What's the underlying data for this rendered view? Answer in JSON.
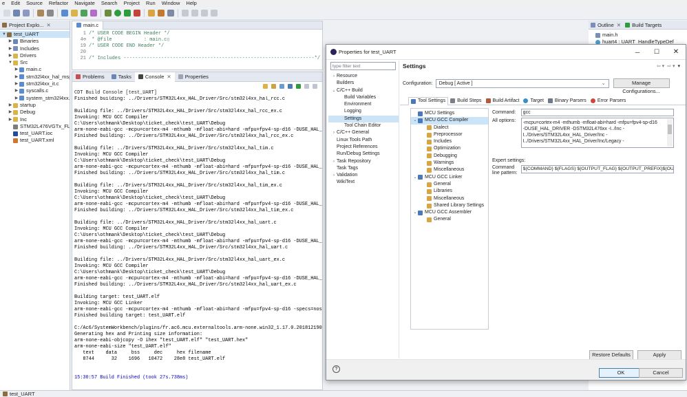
{
  "menubar": [
    "e",
    "Edit",
    "Source",
    "Refactor",
    "Navigate",
    "Search",
    "Project",
    "Run",
    "Window",
    "Help"
  ],
  "project_explorer": {
    "title": "Project Explo...",
    "items": [
      {
        "label": "test_UART",
        "depth": 0,
        "twisty": "▼",
        "icon": "project-icon",
        "selected": true
      },
      {
        "label": "Binaries",
        "depth": 1,
        "twisty": "▶",
        "icon": "binaries-icon"
      },
      {
        "label": "Includes",
        "depth": 1,
        "twisty": "▶",
        "icon": "includes-icon"
      },
      {
        "label": "Drivers",
        "depth": 1,
        "twisty": "▶",
        "icon": "folder-icon"
      },
      {
        "label": "Src",
        "depth": 1,
        "twisty": "▼",
        "icon": "folder-icon"
      },
      {
        "label": "main.c",
        "depth": 2,
        "twisty": "▶",
        "icon": "c-file-icon"
      },
      {
        "label": "stm32l4xx_hal_msp.",
        "depth": 2,
        "twisty": "▶",
        "icon": "c-file-icon"
      },
      {
        "label": "stm32l4xx_it.c",
        "depth": 2,
        "twisty": "▶",
        "icon": "c-file-icon"
      },
      {
        "label": "syscalls.c",
        "depth": 2,
        "twisty": "▶",
        "icon": "c-file-icon"
      },
      {
        "label": "system_stm32l4xx.c",
        "depth": 2,
        "twisty": "▶",
        "icon": "c-file-icon"
      },
      {
        "label": "startup",
        "depth": 1,
        "twisty": "▶",
        "icon": "folder-icon"
      },
      {
        "label": "Debug",
        "depth": 1,
        "twisty": "▶",
        "icon": "folder-icon"
      },
      {
        "label": "Inc",
        "depth": 1,
        "twisty": "▶",
        "icon": "folder-icon"
      },
      {
        "label": "STM32L476VGTx_FLASH",
        "depth": 1,
        "twisty": "",
        "icon": "ld-file-icon"
      },
      {
        "label": "test_UART.ioc",
        "depth": 1,
        "twisty": "",
        "icon": "ioc-file-icon"
      },
      {
        "label": "test_UART.xml",
        "depth": 1,
        "twisty": "",
        "icon": "xml-file-icon"
      }
    ]
  },
  "editor": {
    "tab": "main.c",
    "lines": [
      {
        "num": "1",
        "text": "/* USER CODE BEGIN Header */"
      },
      {
        "num": "4⊖",
        "text": " * @file           : main.c▯"
      },
      {
        "num": "19",
        "text": "/* USER CODE END Header */"
      },
      {
        "num": "20",
        "text": ""
      },
      {
        "num": "21",
        "text": "/* Includes ------------------------------------------------------------------*/"
      }
    ]
  },
  "console": {
    "tabs": [
      "Problems",
      "Tasks",
      "Console",
      "Properties"
    ],
    "title": "CDT Build Console [test_UART]",
    "lines": [
      "Finished building: ../Drivers/STM32L4xx_HAL_Driver/Src/stm32l4xx_hal_rcc.c",
      "",
      "Building file: ../Drivers/STM32L4xx_HAL_Driver/Src/stm32l4xx_hal_rcc_ex.c",
      "Invoking: MCU GCC Compiler",
      "C:\\Users\\othmank\\Desktop\\ticket_check\\test_UART\\Debug",
      "arm-none-eabi-gcc -mcpu=cortex-m4 -mthumb -mfloat-abi=hard -mfpu=fpv4-sp-d16 -DUSE_HAL_",
      "Finished building: ../Drivers/STM32L4xx_HAL_Driver/Src/stm32l4xx_hal_rcc_ex.c",
      "",
      "Building file: ../Drivers/STM32L4xx_HAL_Driver/Src/stm32l4xx_hal_tim.c",
      "Invoking: MCU GCC Compiler",
      "C:\\Users\\othmank\\Desktop\\ticket_check\\test_UART\\Debug",
      "arm-none-eabi-gcc -mcpu=cortex-m4 -mthumb -mfloat-abi=hard -mfpu=fpv4-sp-d16 -DUSE_HAL_",
      "Finished building: ../Drivers/STM32L4xx_HAL_Driver/Src/stm32l4xx_hal_tim.c",
      "",
      "Building file: ../Drivers/STM32L4xx_HAL_Driver/Src/stm32l4xx_hal_tim_ex.c",
      "Invoking: MCU GCC Compiler",
      "C:\\Users\\othmank\\Desktop\\ticket_check\\test_UART\\Debug",
      "arm-none-eabi-gcc -mcpu=cortex-m4 -mthumb -mfloat-abi=hard -mfpu=fpv4-sp-d16 -DUSE_HAL_",
      "Finished building: ../Drivers/STM32L4xx_HAL_Driver/Src/stm32l4xx_hal_tim_ex.c",
      "",
      "Building file: ../Drivers/STM32L4xx_HAL_Driver/Src/stm32l4xx_hal_uart.c",
      "Invoking: MCU GCC Compiler",
      "C:\\Users\\othmank\\Desktop\\ticket_check\\test_UART\\Debug",
      "arm-none-eabi-gcc -mcpu=cortex-m4 -mthumb -mfloat-abi=hard -mfpu=fpv4-sp-d16 -DUSE_HAL_",
      "Finished building: ../Drivers/STM32L4xx_HAL_Driver/Src/stm32l4xx_hal_uart.c",
      "",
      "Building file: ../Drivers/STM32L4xx_HAL_Driver/Src/stm32l4xx_hal_uart_ex.c",
      "Invoking: MCU GCC Compiler",
      "C:\\Users\\othmank\\Desktop\\ticket_check\\test_UART\\Debug",
      "arm-none-eabi-gcc -mcpu=cortex-m4 -mthumb -mfloat-abi=hard -mfpu=fpv4-sp-d16 -DUSE_HAL_",
      "Finished building: ../Drivers/STM32L4xx_HAL_Driver/Src/stm32l4xx_hal_uart_ex.c",
      "",
      "Building target: test_UART.elf",
      "Invoking: MCU GCC Linker",
      "arm-none-eabi-gcc -mcpu=cortex-m4 -mthumb -mfloat-abi=hard -mfpu=fpv4-sp-d16 -specs=nos",
      "Finished building target: test_UART.elf",
      "",
      "C:/Ac6/SystemWorkbench/plugins/fr.ac6.mcu.externaltools.arm-none.win32_1.17.0.201812190",
      "Generating hex and Printing size information:",
      "arm-none-eabi-objcopy -O ihex \"test_UART.elf\" \"test_UART.hex\"",
      "arm-none-eabi-size \"test_UART.elf\"",
      "   text    data     bss     dec     hex filename",
      "   8744      32    1696   10472    28e8 test_UART.elf",
      "",
      "",
      "15:30:57 Build Finished (took 27s.738ms)"
    ],
    "finished_color": "#0000c0"
  },
  "outline": {
    "tabs": [
      "Outline",
      "Build Targets"
    ],
    "items": [
      "main.h",
      "huart4 : UART_HandleTypeDef"
    ]
  },
  "dialog": {
    "title": "Properties for test_UART",
    "filter_placeholder": "type filter text",
    "categories": [
      {
        "label": "Resource",
        "depth": 0,
        "twisty": "›"
      },
      {
        "label": "Builders",
        "depth": 0,
        "twisty": ""
      },
      {
        "label": "C/C++ Build",
        "depth": 0,
        "twisty": "⌄"
      },
      {
        "label": "Build Variables",
        "depth": 1,
        "twisty": ""
      },
      {
        "label": "Environment",
        "depth": 1,
        "twisty": ""
      },
      {
        "label": "Logging",
        "depth": 1,
        "twisty": ""
      },
      {
        "label": "Settings",
        "depth": 1,
        "twisty": "",
        "selected": true
      },
      {
        "label": "Tool Chain Editor",
        "depth": 1,
        "twisty": ""
      },
      {
        "label": "C/C++ General",
        "depth": 0,
        "twisty": "›"
      },
      {
        "label": "Linux Tools Path",
        "depth": 0,
        "twisty": ""
      },
      {
        "label": "Project References",
        "depth": 0,
        "twisty": ""
      },
      {
        "label": "Run/Debug Settings",
        "depth": 0,
        "twisty": ""
      },
      {
        "label": "Task Repository",
        "depth": 0,
        "twisty": "›"
      },
      {
        "label": "Task Tags",
        "depth": 0,
        "twisty": ""
      },
      {
        "label": "Validation",
        "depth": 0,
        "twisty": "›"
      },
      {
        "label": "WikiText",
        "depth": 0,
        "twisty": ""
      }
    ],
    "heading": "Settings",
    "configuration_label": "Configuration:",
    "configuration_value": "Debug  [ Active ]",
    "manage_button": "Manage Configurations...",
    "tabs": [
      "Tool Settings",
      "Build Steps",
      "Build Artifact",
      "Target",
      "Binary Parsers",
      "Error Parsers"
    ],
    "tool_tree": [
      {
        "label": "MCU Settings",
        "depth": 0,
        "twisty": ""
      },
      {
        "label": "MCU GCC Compiler",
        "depth": 0,
        "twisty": "⌄",
        "selected": true
      },
      {
        "label": "Dialect",
        "depth": 1,
        "twisty": ""
      },
      {
        "label": "Preprocessor",
        "depth": 1,
        "twisty": ""
      },
      {
        "label": "Includes",
        "depth": 1,
        "twisty": ""
      },
      {
        "label": "Optimization",
        "depth": 1,
        "twisty": ""
      },
      {
        "label": "Debugging",
        "depth": 1,
        "twisty": ""
      },
      {
        "label": "Warnings",
        "depth": 1,
        "twisty": ""
      },
      {
        "label": "Miscellaneous",
        "depth": 1,
        "twisty": ""
      },
      {
        "label": "MCU GCC Linker",
        "depth": 0,
        "twisty": "⌄"
      },
      {
        "label": "General",
        "depth": 1,
        "twisty": ""
      },
      {
        "label": "Libraries",
        "depth": 1,
        "twisty": ""
      },
      {
        "label": "Miscellaneous",
        "depth": 1,
        "twisty": ""
      },
      {
        "label": "Shared Library Settings",
        "depth": 1,
        "twisty": ""
      },
      {
        "label": "MCU GCC Assembler",
        "depth": 0,
        "twisty": "⌄"
      },
      {
        "label": "General",
        "depth": 1,
        "twisty": ""
      }
    ],
    "command_label": "Command:",
    "command_value": "gcc",
    "all_options_label": "All options:",
    "all_options_lines": [
      "-mcpu=cortex-m4 -mthumb -mfloat-abi=hard -mfpu=fpv4-sp-d16",
      "-DUSE_HAL_DRIVER -DSTM32L476xx -I../Inc -",
      "I../Drivers/STM32L4xx_HAL_Driver/Inc -",
      "I../Drivers/STM32L4xx_HAL_Driver/Inc/Legacy -"
    ],
    "expert_label": "Expert settings:",
    "cmdline_label_1": "Command",
    "cmdline_label_2": "line pattern:",
    "cmdline_value": "${COMMAND} ${FLAGS} ${OUTPUT_FLAG} ${OUTPUT_PREFIX}${OUTPUT",
    "restore_button": "Restore Defaults",
    "apply_button": "Apply",
    "ok_button": "OK",
    "cancel_button": "Cancel"
  },
  "statusbar": {
    "text": "test_UART"
  }
}
